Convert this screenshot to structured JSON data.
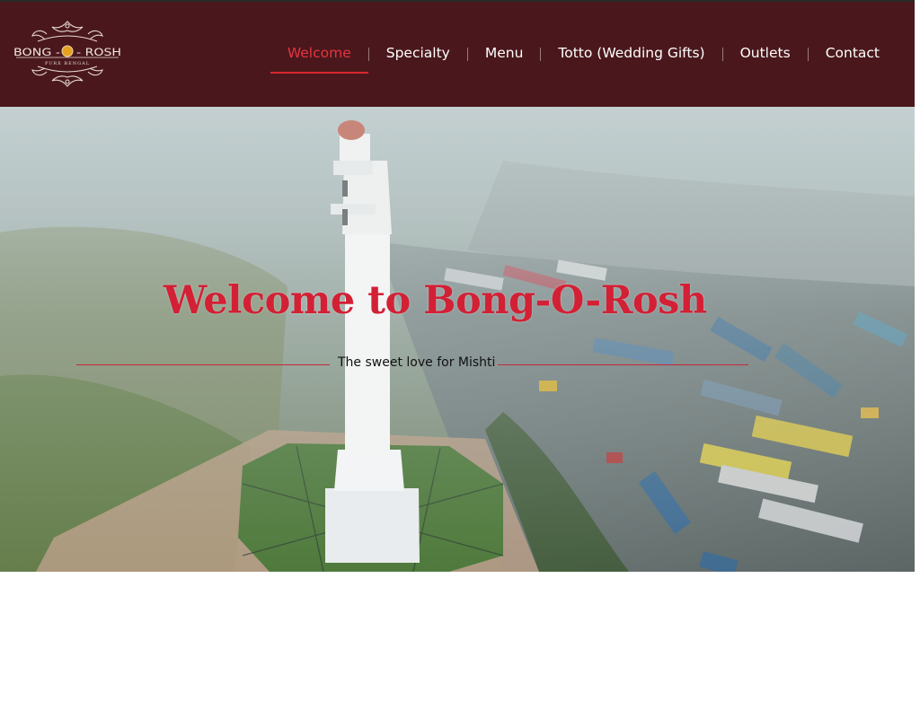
{
  "brand": {
    "logo_text": "BONG - O - ROSH",
    "logo_subtext": "PURE BENGAL"
  },
  "nav": {
    "items": [
      {
        "label": "Welcome",
        "active": true
      },
      {
        "label": "Specialty",
        "active": false
      },
      {
        "label": "Menu",
        "active": false
      },
      {
        "label": "Totto (Wedding Gifts)",
        "active": false
      },
      {
        "label": "Outlets",
        "active": false
      },
      {
        "label": "Contact",
        "active": false
      }
    ]
  },
  "hero": {
    "title": "Welcome to Bong-O-Rosh",
    "tagline": "The sweet love for Mishti"
  },
  "colors": {
    "header_bg": "#4a181c",
    "accent_red": "#d32035",
    "nav_text": "#ffffff"
  }
}
